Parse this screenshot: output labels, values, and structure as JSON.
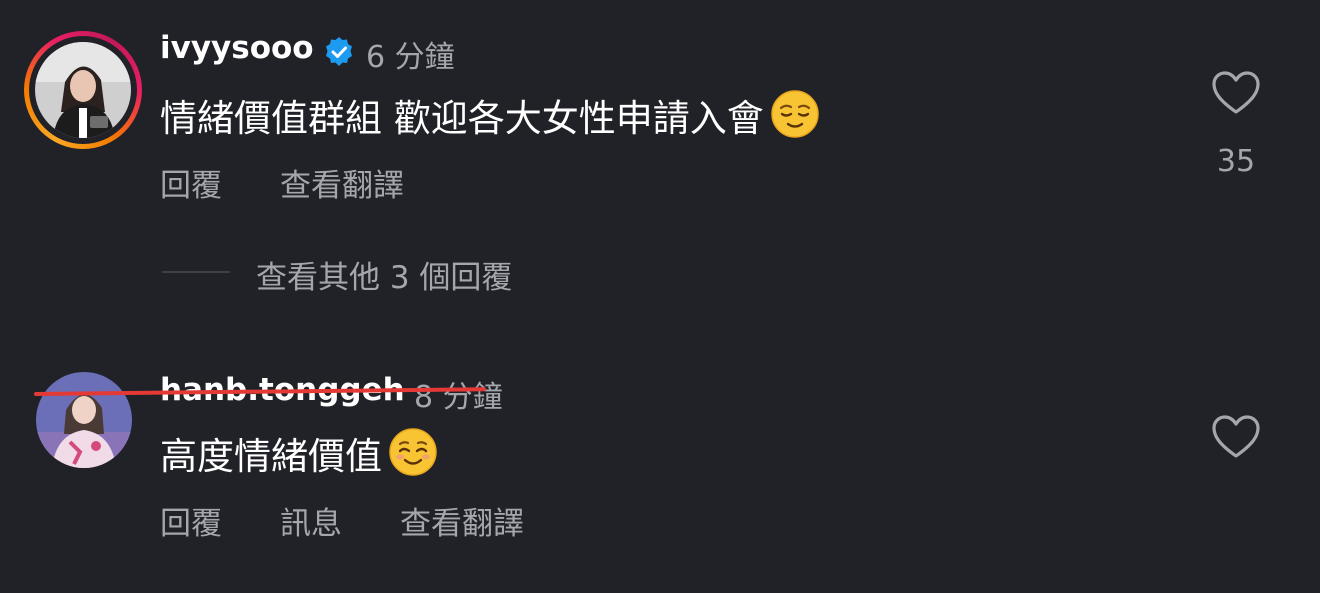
{
  "comments": [
    {
      "username": "ivyysooo",
      "verified": true,
      "time": "6 分鐘",
      "text": "情緒價值群組 歡迎各大女性申請入會",
      "emoji": "relieved-face-emoji",
      "actions": {
        "reply": "回覆",
        "translate": "查看翻譯"
      },
      "likes": "35",
      "view_replies": "查看其他 3 個回覆",
      "avatar_story_ring": true
    },
    {
      "username": "hanb.tonggeh",
      "username_struck_through": true,
      "strike_color": "#e53935",
      "time": "8 分鐘",
      "text": "高度情緒價值",
      "emoji": "smiling-face-emoji",
      "actions": {
        "reply": "回覆",
        "message": "訊息",
        "translate": "查看翻譯"
      }
    }
  ],
  "colors": {
    "background": "#202228",
    "text_primary": "#ffffff",
    "text_secondary": "#a3a6ad",
    "verified": "#1d9bf0"
  }
}
